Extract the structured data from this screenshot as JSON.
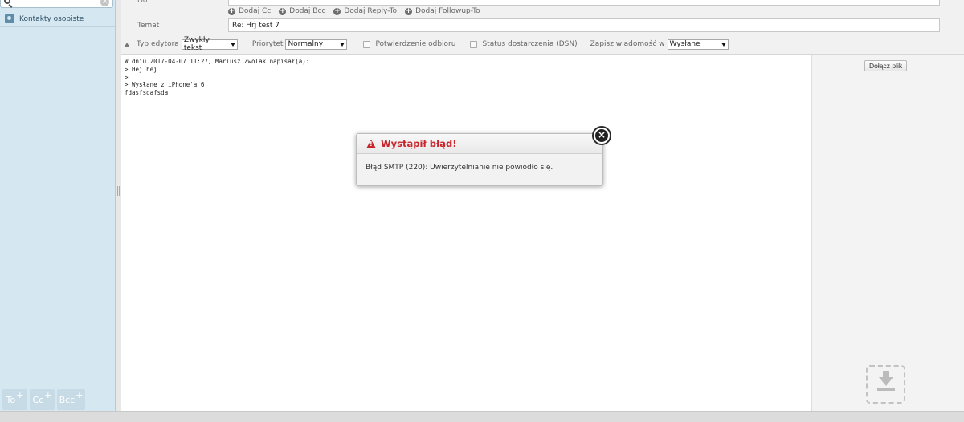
{
  "sidebar": {
    "address_book_label": "Kontakty osobiste",
    "recipient_buttons": [
      {
        "label": "To",
        "plus": "+"
      },
      {
        "label": "Cc",
        "plus": "+"
      },
      {
        "label": "Bcc",
        "plus": "+"
      }
    ]
  },
  "header": {
    "to_label": "Do",
    "links": [
      {
        "label": "Dodaj Cc"
      },
      {
        "label": "Dodaj Bcc"
      },
      {
        "label": "Dodaj Reply-To"
      },
      {
        "label": "Dodaj Followup-To"
      }
    ],
    "subject_label": "Temat",
    "subject_value": "Re: Hrj test 7"
  },
  "options": {
    "editor_type_label": "Typ edytora",
    "editor_type_value": "Zwykły tekst",
    "priority_label": "Priorytet",
    "priority_value": "Normalny",
    "receipt_label": "Potwierdzenie odbioru",
    "dsn_label": "Status dostarczenia (DSN)",
    "save_label": "Zapisz wiadomość w",
    "save_value": "Wysłane"
  },
  "editor": {
    "lines": [
      "W dniu 2017-04-07 11:27, Mariusz Zwolak napisał(a):",
      "> Hej hej",
      ">",
      "> Wysłane z iPhone'a 6",
      "fdasfsdafsda"
    ]
  },
  "attachments": {
    "attach_button_label": "Dołącz plik"
  },
  "dialog": {
    "title": "Wystąpił błąd!",
    "message": "Błąd SMTP (220): Uwierzytelnianie nie powiodło się.",
    "accent_color": "#c8252c"
  }
}
